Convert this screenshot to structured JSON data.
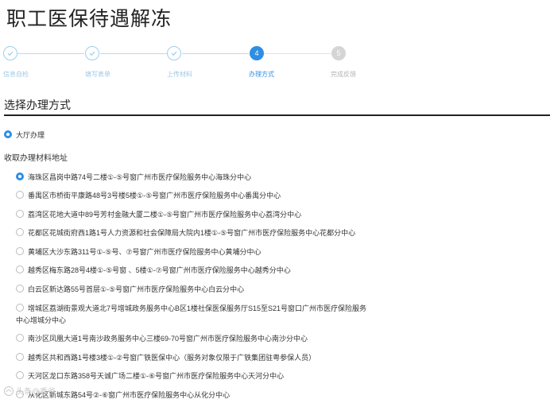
{
  "page": {
    "title": "职工医保待遇解冻"
  },
  "steps": [
    {
      "label": "信息自检",
      "state": "done",
      "number": ""
    },
    {
      "label": "填写表单",
      "state": "done",
      "number": ""
    },
    {
      "label": "上传材料",
      "state": "done",
      "number": ""
    },
    {
      "label": "办理方式",
      "state": "active",
      "number": "4"
    },
    {
      "label": "完成反馈",
      "state": "pending",
      "number": "5"
    }
  ],
  "section": {
    "title": "选择办理方式"
  },
  "method": {
    "label": "大厅办理",
    "checked": true
  },
  "address_heading": "收取办理材料地址",
  "addresses": [
    {
      "line1": "海珠区昌岗中路74号二楼①-⑤号窗广州市医疗保险服务中心海珠分中心",
      "line2": "",
      "checked": true
    },
    {
      "line1": "番禺区市桥街平康路48号3号楼5楼①-⑤号窗广州市医疗保险服务中心番禺分中心",
      "line2": "",
      "checked": false
    },
    {
      "line1": "荔湾区花地大道中89号芳村金融大厦二楼①-⑤号窗广州市医疗保险服务中心荔湾分中心",
      "line2": "",
      "checked": false
    },
    {
      "line1": "花都区花城街府西1路1号人力资源和社会保障局大院内1楼①-⑤号窗广州市医疗保险服务中心花都分中心",
      "line2": "",
      "checked": false
    },
    {
      "line1": "黄埔区大沙东路311号①-⑤号、⑦号窗广州市医疗保险服务中心黄埔分中心",
      "line2": "",
      "checked": false
    },
    {
      "line1": "越秀区梅东路28号4楼①-⑤号窗 、5楼①-⑦号窗广州市医疗保险服务中心越秀分中心",
      "line2": "",
      "checked": false
    },
    {
      "line1": "白云区新达路55号首层①-⑤号窗广州市医疗保险服务中心白云分中心",
      "line2": "",
      "checked": false
    },
    {
      "line1": "增城区荔湖街景观大道北7号增城政务服务中心B区1楼社保医保服务厅S15至S21号窗口广州市医疗保险服务",
      "line2": "中心增城分中心",
      "checked": false
    },
    {
      "line1": "南沙区凤凰大道1号南沙政务服务中心三楼69-70号窗广州市医疗保险服务中心南沙分中心",
      "line2": "",
      "checked": false
    },
    {
      "line1": "越秀区共和西路1号楼3楼①-②号窗广铁医保中心（服务对象仅限于广铁集团驻粤参保人员）",
      "line2": "",
      "checked": false
    },
    {
      "line1": "天河区龙口东路358号天诚广场二楼①-⑥号窗广州市医疗保险服务中心天河分中心",
      "line2": "",
      "checked": false
    },
    {
      "line1": "从化区新城东路54号②-⑥窗广州市医疗保险服务中心从化分中心",
      "line2": "",
      "checked": false
    }
  ],
  "watermark": {
    "text": "头条@秀爸",
    "icon": "watermark-logo-icon"
  },
  "colors": {
    "accent": "#2e8ee4",
    "done": "#9fd0ec",
    "pending": "#d5d5d5",
    "text": "#333333"
  }
}
